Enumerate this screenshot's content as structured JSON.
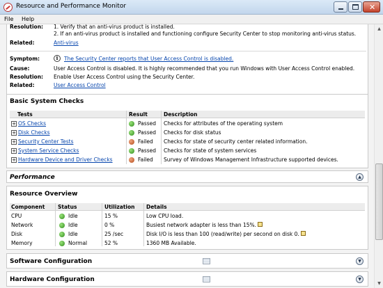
{
  "window": {
    "title": "Resource and Performance Monitor"
  },
  "menu": {
    "file": "File",
    "help": "Help"
  },
  "top_section": {
    "rows": [
      {
        "label": "Resolution:",
        "text": "1. Verify that an anti-virus product is installed."
      },
      {
        "label": "",
        "text": "2. If an anti-virus product is installed and functioning configure Security Center to stop monitoring anti-virus status."
      },
      {
        "label": "Related:",
        "link": "Anti-virus"
      }
    ],
    "symptom": {
      "label": "Symptom:",
      "text": "The Security Center reports that User Access Control is disabled.",
      "icon": "info-icon"
    },
    "cause": {
      "label": "Cause:",
      "text": "User Access Control is disabled. It is highly recommended that you run Windows with User Access Control enabled."
    },
    "resolution": {
      "label": "Resolution:",
      "text": "Enable User Access Control using the Security Center."
    },
    "related": {
      "label": "Related:",
      "link": "User Access Control"
    }
  },
  "basic_checks": {
    "title": "Basic System Checks",
    "columns": [
      "Tests",
      "Result",
      "Description"
    ],
    "rows": [
      {
        "test": "OS Checks",
        "result": "Passed",
        "status": "green",
        "description": "Checks for attributes of the operating system"
      },
      {
        "test": "Disk Checks",
        "result": "Passed",
        "status": "green",
        "description": "Checks for disk status"
      },
      {
        "test": "Security Center Tests",
        "result": "Failed",
        "status": "red",
        "description": "Checks for state of security center related information."
      },
      {
        "test": "System Service Checks",
        "result": "Passed",
        "status": "green",
        "description": "Checks for state of system services"
      },
      {
        "test": "Hardware Device and Driver Checks",
        "result": "Failed",
        "status": "red",
        "description": "Survey of Windows Management Infrastructure supported devices."
      }
    ]
  },
  "performance": {
    "title": "Performance"
  },
  "resource_overview": {
    "title": "Resource Overview",
    "columns": [
      "Component",
      "Status",
      "Utilization",
      "Details"
    ],
    "rows": [
      {
        "component": "CPU",
        "status": "Idle",
        "utilization": "15 %",
        "details": "Low CPU load."
      },
      {
        "component": "Network",
        "status": "Idle",
        "utilization": "0 %",
        "details": "Busiest network adapter is less than 15%."
      },
      {
        "component": "Disk",
        "status": "Idle",
        "utilization": "25 /sec",
        "details": "Disk I/O is less than 100 (read/write) per second on disk 0."
      },
      {
        "component": "Memory",
        "status": "Normal",
        "utilization": "52 %",
        "details": "1360 MB Available."
      }
    ]
  },
  "software_configuration": {
    "title": "Software Configuration"
  },
  "hardware_configuration": {
    "title": "Hardware Configuration"
  },
  "colors": {
    "link": "#0645ad",
    "passed": "#2f8a1a",
    "failed": "#b24a18"
  }
}
